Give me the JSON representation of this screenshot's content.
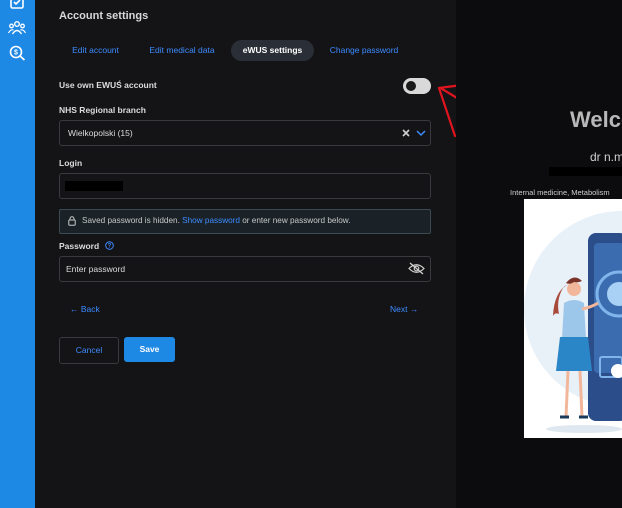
{
  "header": {
    "title": "Account settings"
  },
  "tabs": [
    {
      "label": "Edit account"
    },
    {
      "label": "Edit medical data"
    },
    {
      "label": "eWUS settings"
    },
    {
      "label": "Change password"
    }
  ],
  "form": {
    "use_own_label": "Use own EWUŚ account",
    "branch_label": "NHS Regional branch",
    "branch_value": "Wielkopolski (15)",
    "login_label": "Login",
    "info_text_before": "Saved password is hidden.",
    "info_link": "Show password",
    "info_text_after": "or enter new password below.",
    "password_label": "Password",
    "password_placeholder": "Enter password",
    "back_label": "← Back",
    "next_label": "Next →",
    "cancel_label": "Cancel",
    "save_label": "Save"
  },
  "profile": {
    "welcome": "Welco",
    "name": "dr n.m",
    "specialty": "Internal medicine, Metabolism"
  },
  "colors": {
    "accent": "#1e88e5",
    "link": "#3d8bff",
    "annotation": "#e0141e"
  }
}
